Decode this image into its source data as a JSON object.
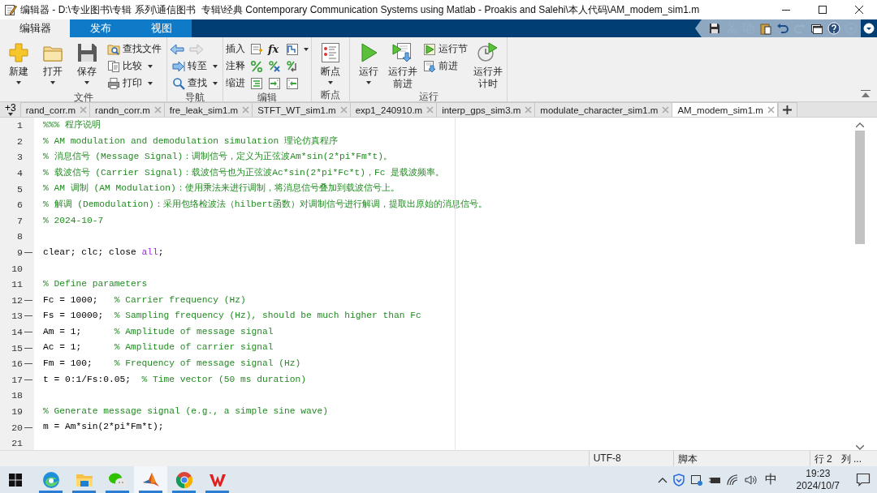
{
  "window": {
    "title": "编辑器 - D:\\专业图书\\专辑 系列\\通信图书  专辑\\经典 Contemporary Communication Systems using Matlab - Proakis and Salehi\\本人代码\\AM_modem_sim1.m"
  },
  "ribbon_tabs": [
    {
      "label": "编辑器",
      "selected": true
    },
    {
      "label": "发布",
      "selected": false
    },
    {
      "label": "视图",
      "selected": false
    }
  ],
  "quick_access": [
    {
      "disabled": false
    },
    {
      "disabled": true
    },
    {
      "disabled": true
    },
    {
      "disabled": false
    },
    {
      "disabled": false
    },
    {
      "disabled": true
    },
    {
      "disabled": false
    },
    {
      "disabled": false
    },
    {
      "disabled": true
    }
  ],
  "ribbon_groups": [
    {
      "title": "文件",
      "items": [
        {
          "kind": "large",
          "label": "新建",
          "dropdown": true
        },
        {
          "kind": "large",
          "label": "打开",
          "dropdown": true
        },
        {
          "kind": "large",
          "label": "保存",
          "dropdown": true
        },
        {
          "kind": "small",
          "label": "查找文件",
          "dropdown": false
        },
        {
          "kind": "small",
          "label": "比较",
          "dropdown": true
        },
        {
          "kind": "small",
          "label": "打印",
          "dropdown": true
        }
      ]
    },
    {
      "title": "导航",
      "items": [
        {
          "kind": "nav-arrows"
        },
        {
          "kind": "small",
          "label": "转至",
          "dropdown": true
        },
        {
          "kind": "small",
          "label": "查找",
          "dropdown": true
        }
      ]
    },
    {
      "title": "编辑",
      "items": [
        {
          "kind": "tool-row",
          "label": "插入",
          "symbol": "fx",
          "dropdown": true
        },
        {
          "kind": "tool-row",
          "label": "注释",
          "dropdown": false
        },
        {
          "kind": "tool-row",
          "label": "缩进",
          "dropdown": false
        }
      ]
    },
    {
      "title": "断点",
      "items": [
        {
          "kind": "large",
          "label": "断点",
          "dropdown": true
        }
      ]
    },
    {
      "title": "运行",
      "items": [
        {
          "kind": "large",
          "label": "运行",
          "dropdown": true
        },
        {
          "kind": "large",
          "label": "运行并前进",
          "dropdown": false
        },
        {
          "kind": "small",
          "label": "运行节",
          "dropdown": false
        },
        {
          "kind": "small",
          "label": "前进",
          "dropdown": false
        },
        {
          "kind": "large",
          "label": "运行并计时",
          "dropdown": false
        }
      ]
    }
  ],
  "file_tabs": {
    "overflow": "+3",
    "tabs": [
      {
        "label": "rand_corr.m",
        "selected": false
      },
      {
        "label": "randn_corr.m",
        "selected": false
      },
      {
        "label": "fre_leak_sim1.m",
        "selected": false
      },
      {
        "label": "STFT_WT_sim1.m",
        "selected": false
      },
      {
        "label": "exp1_240910.m",
        "selected": false
      },
      {
        "label": "interp_gps_sim3.m",
        "selected": false
      },
      {
        "label": "modulate_character_sim1.m",
        "selected": false
      },
      {
        "label": "AM_modem_sim1.m",
        "selected": true
      }
    ]
  },
  "editor": {
    "lines": [
      {
        "number": "1",
        "executable": false,
        "tokens": [
          {
            "kind": "comment",
            "text": "%%% 程序说明"
          }
        ]
      },
      {
        "number": "2",
        "executable": false,
        "tokens": [
          {
            "kind": "comment",
            "text": "% AM modulation and demodulation simulation 理论仿真程序"
          }
        ]
      },
      {
        "number": "3",
        "executable": false,
        "tokens": [
          {
            "kind": "comment",
            "text": "% 消息信号 (Message Signal)：调制信号，定义为正弦波Am*sin(2*pi*Fm*t)。"
          }
        ]
      },
      {
        "number": "4",
        "executable": false,
        "tokens": [
          {
            "kind": "comment",
            "text": "% 载波信号 (Carrier Signal)：载波信号也为正弦波Ac*sin(2*pi*Fc*t)，Fc 是载波频率。"
          }
        ]
      },
      {
        "number": "5",
        "executable": false,
        "tokens": [
          {
            "kind": "comment",
            "text": "% AM 调制 (AM Modulation)：使用乘法来进行调制，将消息信号叠加到载波信号上。"
          }
        ]
      },
      {
        "number": "6",
        "executable": false,
        "tokens": [
          {
            "kind": "comment",
            "text": "% 解调 (Demodulation)：采用包络检波法（hilbert函数）对调制信号进行解调，提取出原始的消息信号。"
          }
        ]
      },
      {
        "number": "7",
        "executable": false,
        "tokens": [
          {
            "kind": "comment",
            "text": "% 2024-10-7"
          }
        ]
      },
      {
        "number": "8",
        "executable": false
      },
      {
        "number": "9",
        "executable": true,
        "tokens": [
          {
            "kind": "code",
            "text": "clear; clc; close "
          },
          {
            "kind": "string",
            "text": "all"
          },
          {
            "kind": "code",
            "text": ";"
          }
        ]
      },
      {
        "number": "10",
        "executable": false
      },
      {
        "number": "11",
        "executable": false,
        "tokens": [
          {
            "kind": "comment",
            "text": "% Define parameters"
          }
        ]
      },
      {
        "number": "12",
        "executable": true,
        "tokens": [
          {
            "kind": "code",
            "text": "Fc = 1000;   "
          },
          {
            "kind": "comment",
            "text": "% Carrier frequency (Hz)"
          }
        ]
      },
      {
        "number": "13",
        "executable": true,
        "tokens": [
          {
            "kind": "code",
            "text": "Fs = 10000;  "
          },
          {
            "kind": "comment",
            "text": "% Sampling frequency (Hz), should be much higher than Fc"
          }
        ]
      },
      {
        "number": "14",
        "executable": true,
        "tokens": [
          {
            "kind": "code",
            "text": "Am = 1;      "
          },
          {
            "kind": "comment",
            "text": "% Amplitude of message signal"
          }
        ]
      },
      {
        "number": "15",
        "executable": true,
        "tokens": [
          {
            "kind": "code",
            "text": "Ac = 1;      "
          },
          {
            "kind": "comment",
            "text": "% Amplitude of carrier signal"
          }
        ]
      },
      {
        "number": "16",
        "executable": true,
        "tokens": [
          {
            "kind": "code",
            "text": "Fm = 100;    "
          },
          {
            "kind": "comment",
            "text": "% Frequency of message signal (Hz)"
          }
        ]
      },
      {
        "number": "17",
        "executable": true,
        "tokens": [
          {
            "kind": "code",
            "text": "t = 0:1/Fs:0.05;  "
          },
          {
            "kind": "comment",
            "text": "% Time vector (50 ms duration)"
          }
        ]
      },
      {
        "number": "18",
        "executable": false
      },
      {
        "number": "19",
        "executable": false,
        "tokens": [
          {
            "kind": "comment",
            "text": "% Generate message signal (e.g., a simple sine wave)"
          }
        ]
      },
      {
        "number": "20",
        "executable": true,
        "tokens": [
          {
            "kind": "code",
            "text": "m = Am*sin(2*pi*Fm*t);"
          }
        ]
      },
      {
        "number": "21",
        "executable": false
      }
    ]
  },
  "status_bar": {
    "encoding": "UTF-8",
    "type": "脚本",
    "line": "行 2",
    "column": "列 ..."
  },
  "taskbar": {
    "apps": [
      {
        "running": true,
        "selected": false
      },
      {
        "running": true,
        "selected": false
      },
      {
        "running": true,
        "selected": false
      },
      {
        "running": true,
        "selected": true
      },
      {
        "running": true,
        "selected": false
      },
      {
        "running": true,
        "selected": false
      }
    ],
    "input_method": "中",
    "time": "19:23",
    "date": "2024/10/7"
  }
}
